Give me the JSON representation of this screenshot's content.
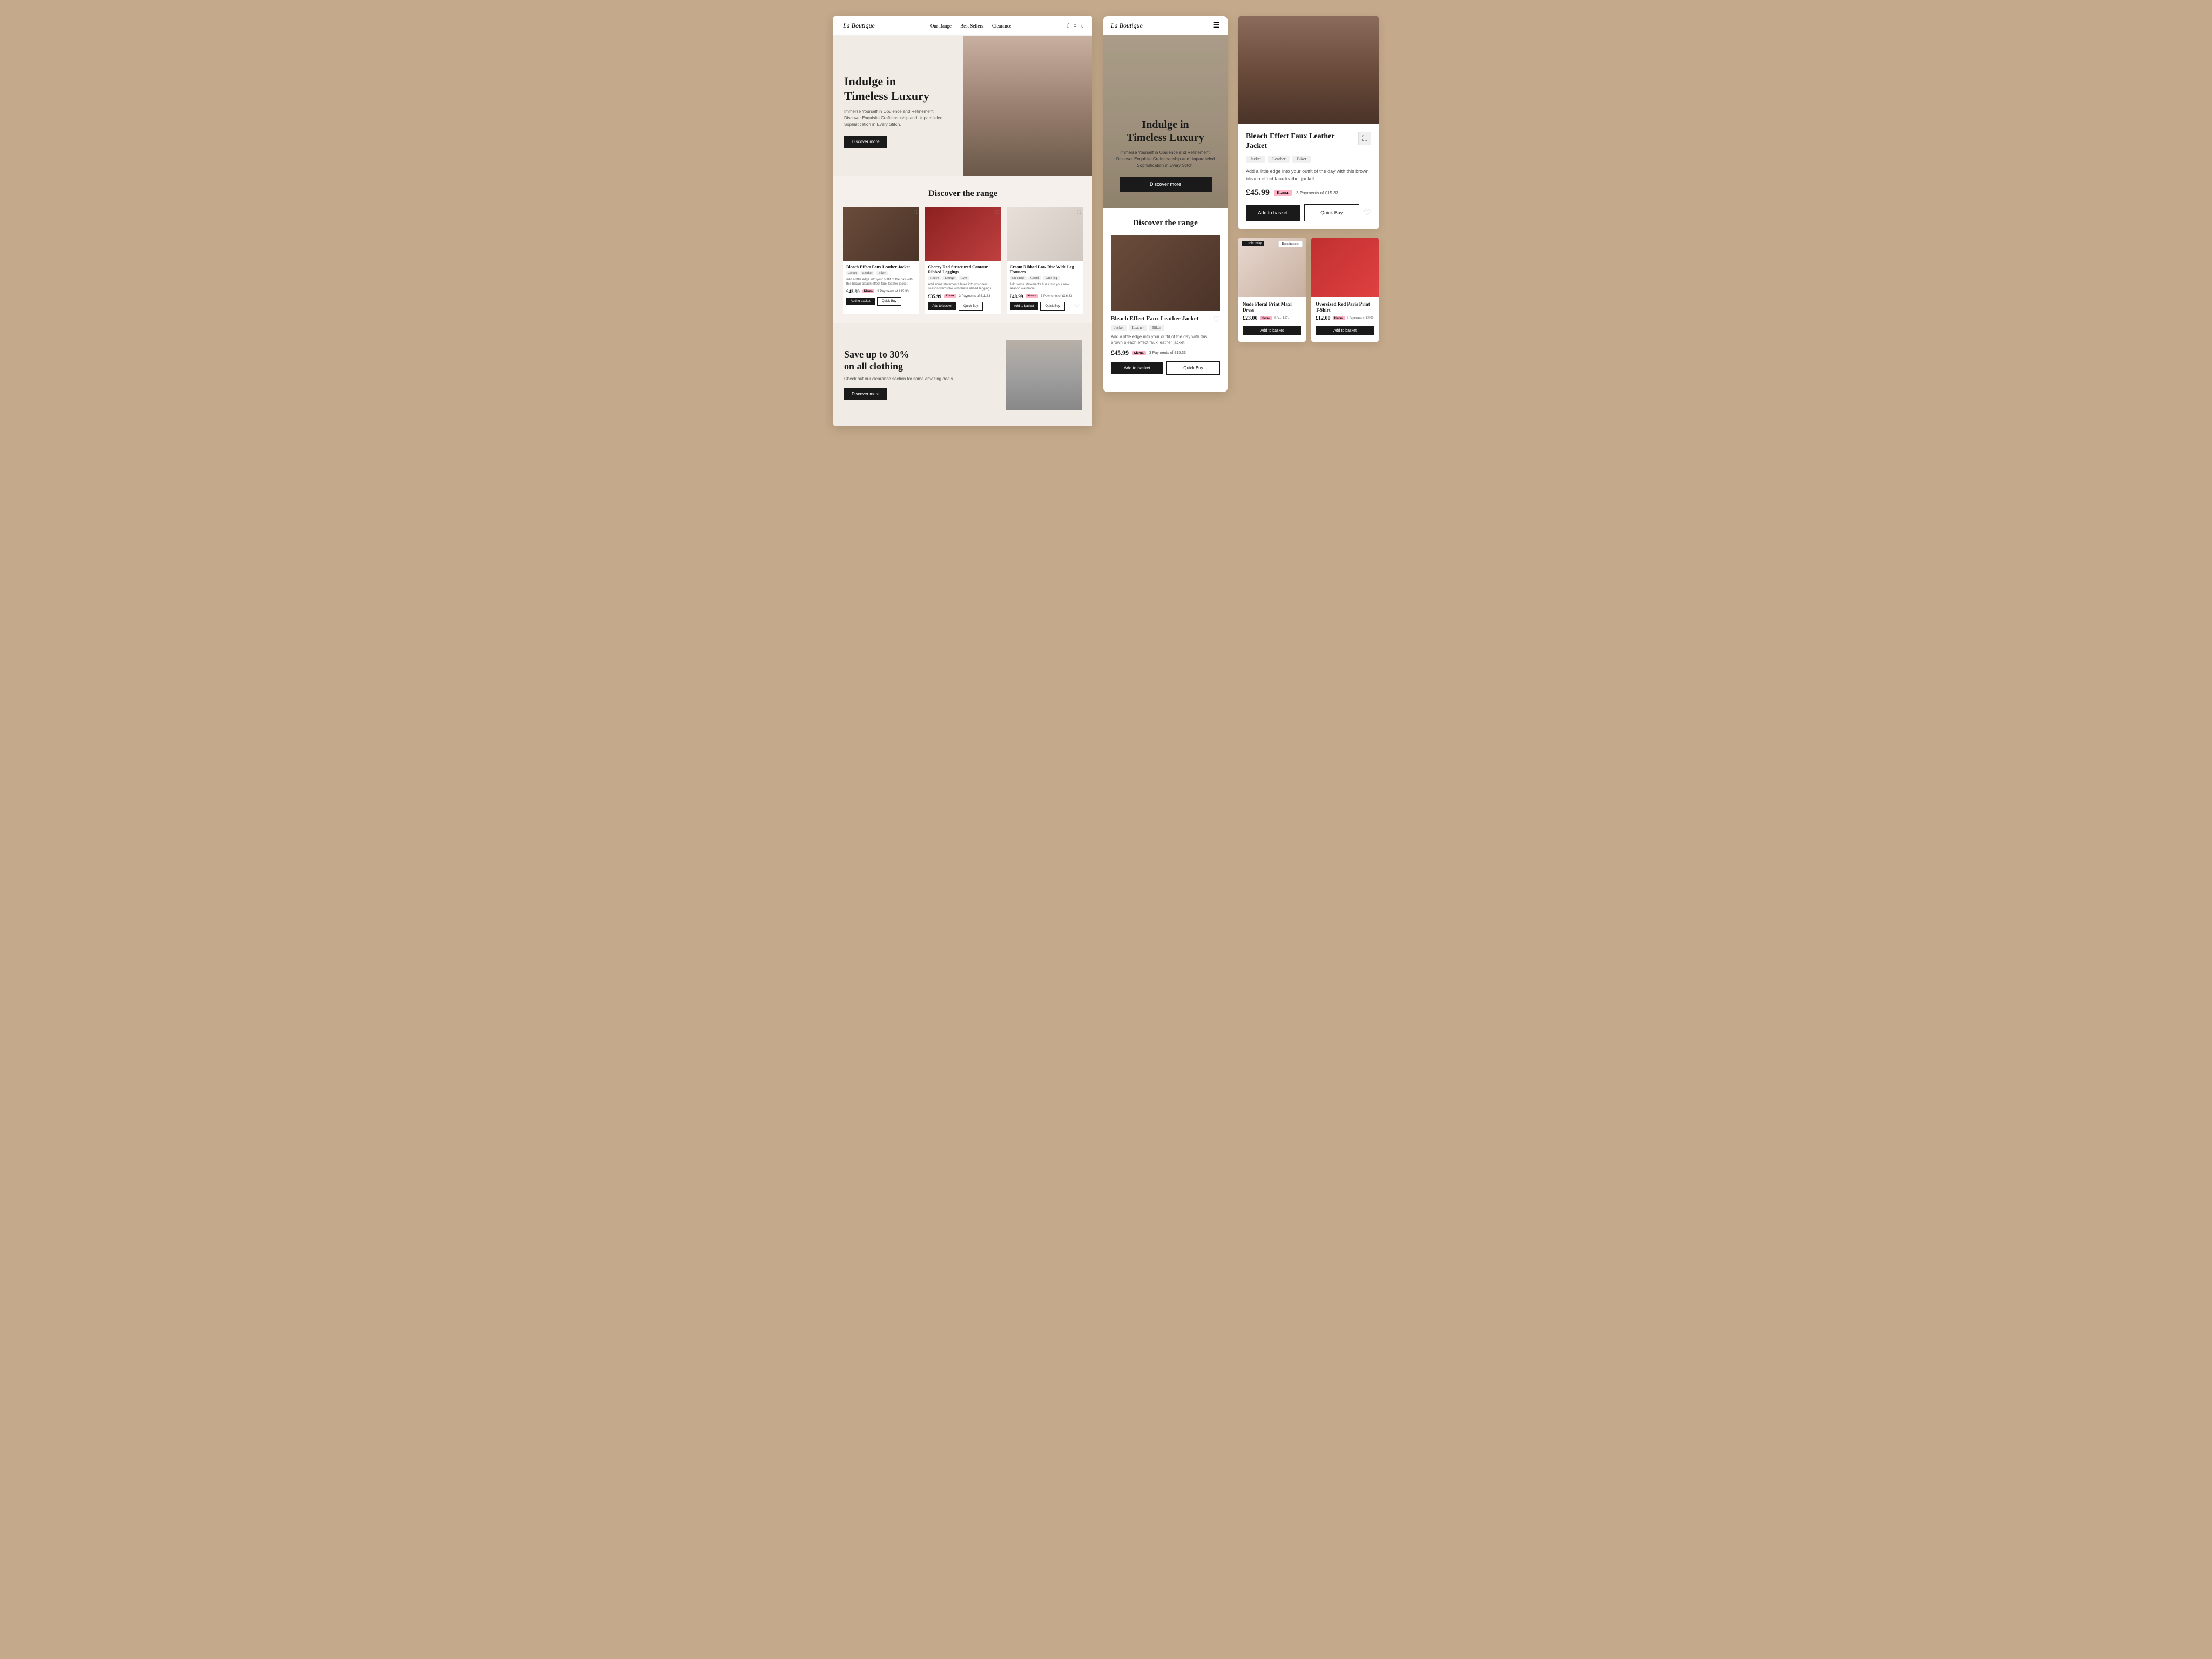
{
  "site": {
    "logo": "La Boutique",
    "nav_links": [
      "Our Range",
      "Best Sellers",
      "Clearance"
    ],
    "social_icons": [
      "f",
      "instagram",
      "twitter"
    ]
  },
  "desktop": {
    "hero": {
      "title_line1": "Indulge in",
      "title_line2": "Timeless Luxury",
      "subtitle": "Immerse Yourself in Opulence and Refinement. Discover Exquisite Craftsmanship and Unparalleled Sophistication in Every Stitch.",
      "cta": "Discover more"
    },
    "range_section": {
      "heading": "Discover the range"
    },
    "products": [
      {
        "title": "Bleach Effect Faux Leather Jacket",
        "tags": [
          "Jacket",
          "Leather",
          "Biker"
        ],
        "description": "Add a little edge into your outfit of the day with this brown bleach effect faux leather jacket.",
        "price": "£45.99",
        "klarna_text": "3 Payments of £15.33",
        "color": "dark"
      },
      {
        "title": "Cherry Red Structured Contour Ribbed Leggings",
        "tags": [
          "Active",
          "Lounge",
          "Gym"
        ],
        "description": "Add some statements hues into your new season wardrobe with these ribbed leggings.",
        "price": "£35.99",
        "klarna_text": "3 Payments of £11.33",
        "color": "red"
      },
      {
        "title": "Cream Ribbed Low Rise Wide Leg Trousers",
        "tags": [
          "On-Trend",
          "Casual",
          "Wide-leg"
        ],
        "description": "Add some statements hues into your new season wardrobe.",
        "price": "£48.99",
        "klarna_text": "3 Payments of £16.33",
        "color": "cream"
      }
    ],
    "clearance": {
      "title_line1": "Save up to 30%",
      "title_line2": "on all clothing",
      "subtitle": "Check out our clearance section for some amazing deals.",
      "cta": "Discover more"
    },
    "add_to_basket": "Add to basket",
    "quick_buy": "Quick Buy"
  },
  "mobile": {
    "logo": "La Boutique",
    "hero": {
      "title_line1": "Indulge in",
      "title_line2": "Timeless Luxury",
      "subtitle": "Immerse Yourself in Opulence and Refinement. Discover Exquisite Craftsmanship and Unparalleled Sophistication in Every Stitch.",
      "cta": "Discover more"
    },
    "range_section": {
      "heading": "Discover the range"
    },
    "product": {
      "title": "Bleach Effect Faux Leather Jacket",
      "tags": [
        "Jacket",
        "Leather",
        "Biker"
      ],
      "description": "Add a little edge into your outfit of the day with this brown bleach effect faux leather jacket.",
      "price": "£45.99",
      "klarna_text": "3 Payments of £15.33"
    },
    "add_to_basket": "Add to basket",
    "quick_buy": "Quick Buy"
  },
  "product_detail": {
    "title": "Bleach Effect Faux Leather Jacket",
    "tags": [
      "Jacket",
      "Leather",
      "Biker"
    ],
    "description": "Add a little edge into your outfit of the day with this brown bleach effect faux leather jacket.",
    "price": "£45.99",
    "klarna_text": "3 Payments of £15.33",
    "add_to_basket": "Add to basket",
    "quick_buy": "Quick Buy"
  },
  "mini_products": [
    {
      "title": "Nude Floral Print Maxi Dress",
      "price": "£23.00",
      "klarna_text": "3 Pa... £17...",
      "badge": "10 sold today",
      "back_stock": "Back in stock",
      "add_to_basket": "Add to basket",
      "color": "floral"
    },
    {
      "title": "Oversized Red Paris Print T-Shirt",
      "price": "£12.00",
      "klarna_text": "3 Payments of £4.00",
      "add_to_basket": "Add to basket",
      "color": "paris"
    }
  ]
}
